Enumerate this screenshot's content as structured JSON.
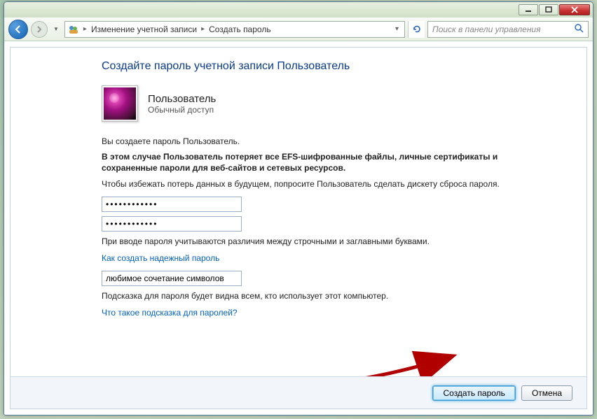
{
  "breadcrumb": {
    "item1": "Изменение учетной записи",
    "item2": "Создать пароль"
  },
  "search": {
    "placeholder": "Поиск в панели управления"
  },
  "page": {
    "title": "Создайте пароль учетной записи Пользователь"
  },
  "user": {
    "name": "Пользователь",
    "role": "Обычный доступ"
  },
  "text": {
    "line1": "Вы создаете пароль Пользователь.",
    "warn": "В этом случае Пользователь потеряет все EFS-шифрованные файлы, личные сертификаты и сохраненные пароли для веб-сайтов и сетевых ресурсов.",
    "line3": "Чтобы избежать потерь данных в будущем, попросите Пользователь сделать дискету сброса пароля.",
    "caseNote": "При вводе пароля учитываются различия между строчными и заглавными буквами.",
    "link1": "Как создать надежный пароль",
    "hintNote": "Подсказка для пароля будет видна всем, кто использует этот компьютер.",
    "link2": "Что такое подсказка для паролей?"
  },
  "inputs": {
    "pwd1": "••••••••••••",
    "pwd2": "••••••••••••",
    "hint": "любимое сочетание символов"
  },
  "buttons": {
    "create": "Создать пароль",
    "cancel": "Отмена"
  }
}
